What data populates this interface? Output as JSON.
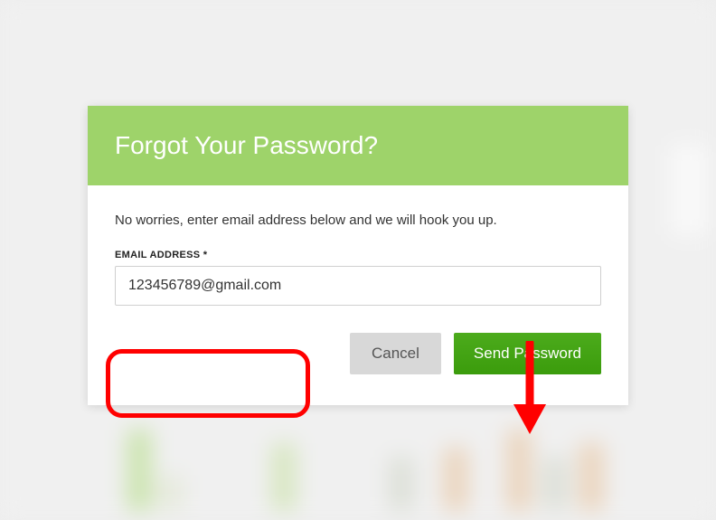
{
  "modal": {
    "title": "Forgot Your Password?",
    "helper_text": "No worries, enter email address below and we will hook you up.",
    "email_label": "EMAIL ADDRESS *",
    "email_value": "123456789@gmail.com",
    "buttons": {
      "cancel": "Cancel",
      "send": "Send Password"
    }
  },
  "annotation": {
    "color": "#ff0000"
  }
}
